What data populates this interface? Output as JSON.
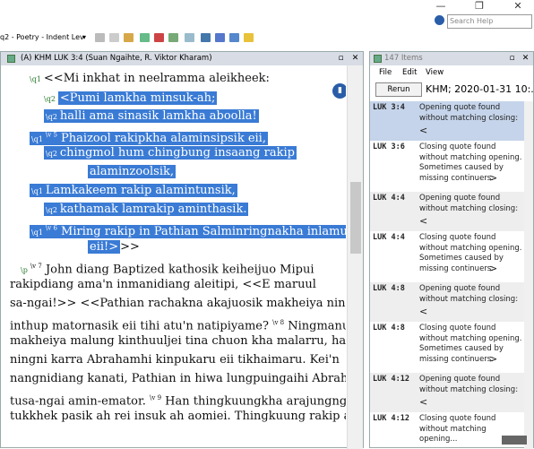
{
  "window": {
    "minimize": "—",
    "restore": "❐",
    "close": "✕",
    "help_icon": "help-icon"
  },
  "search": {
    "placeholder": "Search Help"
  },
  "toolbar": {
    "style_value": "q2 - Poetry - Indent Lev"
  },
  "left": {
    "title": "(A) KHM LUK 3:4 (Suan Ngaihte, R. Viktor Kharam)",
    "lines": [
      {
        "id": "l0",
        "t": "<<Mi inkhat in neelramma aleikheek:",
        "hl": false,
        "mk": "\\q1"
      },
      {
        "id": "l1",
        "t": "<Pumi lamkha minsuk-ah;",
        "hl": true,
        "mk": "\\q2"
      },
      {
        "id": "l2",
        "t": "halli ama sinasik lamkha aboolla!",
        "hl": true,
        "mk": "\\q2"
      },
      {
        "id": "l3",
        "t": "Phaizool rakipkha alaminsipsik eii,",
        "hl": true,
        "mk": "\\q1",
        "v": "5"
      },
      {
        "id": "l4",
        "t": "chingmol hum chingbung insaang rakip",
        "hl": true,
        "mk": "\\q2"
      },
      {
        "id": "l5",
        "t": "alaminzoolsik,",
        "hl": true,
        "mk": ""
      },
      {
        "id": "l6",
        "t": "Lamkakeem rakip alamintunsik,",
        "hl": true,
        "mk": "\\q1"
      },
      {
        "id": "l7",
        "t": "kathamak lamrakip aminthasik.",
        "hl": true,
        "mk": "\\q2"
      },
      {
        "id": "l8",
        "t": "Miring rakip in Pathian Salminringnakha inlamusik",
        "hl": true,
        "mk": "\\q1",
        "v": "6"
      },
      {
        "id": "l9",
        "t": "eii!>",
        "hl": true,
        "mk": ""
      },
      {
        "id": "l9b",
        "t": ">>",
        "hl": false,
        "mk": ""
      },
      {
        "id": "l10",
        "t": "John diang Baptized kathosik keiheijuo Mipui",
        "hl": false,
        "mk": "\\p",
        "v": "7"
      },
      {
        "id": "l11",
        "t": "rakipdiang ama'n inmanidiang aleitipi, <<E maruul",
        "hl": false,
        "mk": ""
      },
      {
        "id": "l12",
        "t": "sa-ngai!>> <<Pathian rachakna akajuosik makheiya ning",
        "hl": false,
        "mk": ""
      },
      {
        "id": "l13",
        "t": "inthup matornasik eii tihi atu'n natipiyame?",
        "hl": false,
        "mk": "",
        "v2": "8"
      },
      {
        "id": "l13b",
        "t": "Ningmanu",
        "hl": false,
        "mk": ""
      },
      {
        "id": "l14",
        "t": "makheiya malung kinthuuljei tina chuon kha malarru, halli",
        "hl": false,
        "mk": ""
      },
      {
        "id": "l15",
        "t": "ningni karra Abrahamhi kinpukaru eii tikhaimaru. Kei'n",
        "hl": false,
        "mk": ""
      },
      {
        "id": "l16",
        "t": "nangnidiang kanati, Pathian in hiwa lungpuingaihi Abraham",
        "hl": false,
        "mk": ""
      },
      {
        "id": "l17",
        "t": "tusa-ngai amin-emator.",
        "hl": false,
        "mk": "",
        "v2": "9"
      },
      {
        "id": "l17b",
        "t": "Han thingkuungkha arajungnga",
        "hl": false,
        "mk": ""
      },
      {
        "id": "l18",
        "t": "tukkhek pasik ah rei insuk ah aomiei. Thingkuung rakip akara",
        "hl": false,
        "mk": ""
      }
    ]
  },
  "right": {
    "title": "147 Items",
    "menu": {
      "file": "File",
      "edit": "Edit",
      "view": "View"
    },
    "rerun": "Rerun",
    "khm": "KHM; 2020-01-31 10:...",
    "items": [
      {
        "ref": "LUK  3:4",
        "msg": "Opening quote found without matching closing:",
        "q": "<",
        "sel": true
      },
      {
        "ref": "LUK  3:6",
        "msg": "Closing quote found without matching opening. Sometimes caused by missing continuers:",
        "q": ">"
      },
      {
        "ref": "LUK  4:4",
        "msg": "Opening quote found without matching closing:",
        "q": "<"
      },
      {
        "ref": "LUK  4:4",
        "msg": "Closing quote found without matching opening. Sometimes caused by missing continuers:",
        "q": ">"
      },
      {
        "ref": "LUK  4:8",
        "msg": "Opening quote found without matching closing:",
        "q": "<"
      },
      {
        "ref": "LUK  4:8",
        "msg": "Closing quote found without matching opening. Sometimes caused by missing continuers:",
        "q": ">"
      },
      {
        "ref": "LUK  4:12",
        "msg": "Opening quote found without matching closing:",
        "q": "<"
      },
      {
        "ref": "LUK  4:12",
        "msg": "Closing quote found without matching opening...",
        "q": ""
      }
    ]
  }
}
